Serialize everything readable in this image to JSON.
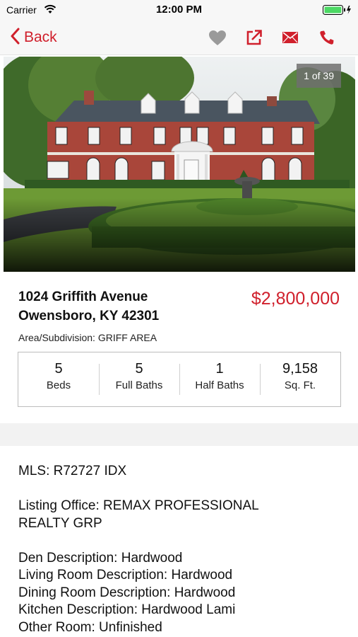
{
  "status_bar": {
    "carrier": "Carrier",
    "time": "12:00 PM"
  },
  "nav": {
    "back_label": "Back",
    "icons": [
      "heart-icon",
      "share-icon",
      "mail-icon",
      "phone-icon"
    ]
  },
  "colors": {
    "accent": "#d0202c",
    "heart": "#9a9a9a"
  },
  "photo": {
    "counter": "1 of 39"
  },
  "listing": {
    "address_line1": "1024 Griffith Avenue",
    "address_line2": "Owensboro, KY 42301",
    "price": "$2,800,000",
    "area": "Area/Subdivision: GRIFF AREA"
  },
  "stats": [
    {
      "value": "5",
      "label": "Beds"
    },
    {
      "value": "5",
      "label": "Full Baths"
    },
    {
      "value": "1",
      "label": "Half Baths"
    },
    {
      "value": "9,158",
      "label": "Sq. Ft."
    }
  ],
  "details": {
    "mls": "MLS: R72727 IDX",
    "office_line1": "Listing Office: REMAX PROFESSIONAL",
    "office_line2": "REALTY GRP",
    "rooms": [
      "Den Description: Hardwood",
      "Living Room Description: Hardwood",
      "Dining Room Description: Hardwood",
      "Kitchen Description: Hardwood Lami",
      "Other Room: Unfinished"
    ]
  }
}
